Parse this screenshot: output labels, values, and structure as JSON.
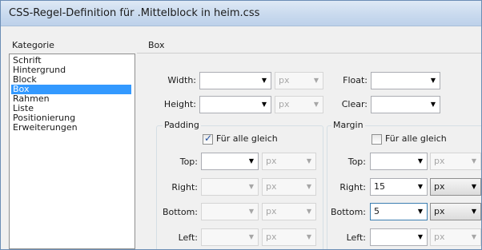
{
  "window": {
    "title": "CSS-Regel-Definition für .Mittelblock in heim.css"
  },
  "category": {
    "header": "Kategorie",
    "items": [
      "Schrift",
      "Hintergrund",
      "Block",
      "Box",
      "Rahmen",
      "Liste",
      "Positionierung",
      "Erweiterungen"
    ],
    "selected": "Box"
  },
  "box": {
    "header": "Box",
    "width": {
      "label": "Width:",
      "value": "",
      "unit": "px"
    },
    "height": {
      "label": "Height:",
      "value": "",
      "unit": "px"
    },
    "float": {
      "label": "Float:",
      "value": ""
    },
    "clear": {
      "label": "Clear:",
      "value": ""
    }
  },
  "padding": {
    "title": "Padding",
    "same_for_all": {
      "label": "Für alle gleich",
      "checked": true
    },
    "top": {
      "label": "Top:",
      "value": "",
      "unit": "px"
    },
    "right": {
      "label": "Right:",
      "value": "",
      "unit": "px"
    },
    "bottom": {
      "label": "Bottom:",
      "value": "",
      "unit": "px"
    },
    "left": {
      "label": "Left:",
      "value": "",
      "unit": "px"
    }
  },
  "margin": {
    "title": "Margin",
    "same_for_all": {
      "label": "Für alle gleich",
      "checked": false
    },
    "top": {
      "label": "Top:",
      "value": "",
      "unit": "px"
    },
    "right": {
      "label": "Right:",
      "value": "15",
      "unit": "px"
    },
    "bottom": {
      "label": "Bottom:",
      "value": "5",
      "unit": "px"
    },
    "left": {
      "label": "Left:",
      "value": "",
      "unit": "px"
    }
  },
  "icons": {
    "dropdown": "chevron-down-icon",
    "check": "checkmark-icon"
  }
}
